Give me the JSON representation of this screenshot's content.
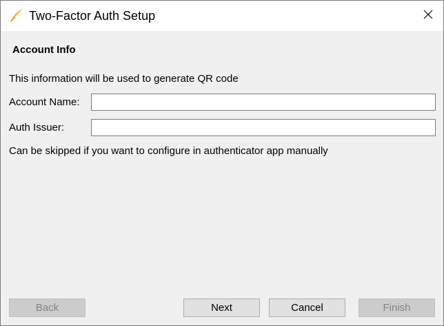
{
  "window": {
    "title": "Two-Factor Auth Setup",
    "icon": "feather-logo-icon",
    "close_icon": "close-icon"
  },
  "section": {
    "title": "Account Info"
  },
  "form": {
    "info_text": "This information will be used to generate QR code",
    "account_name_label": "Account Name:",
    "account_name_value": "",
    "auth_issuer_label": "Auth Issuer:",
    "auth_issuer_value": "",
    "hint_text": "Can be skipped if you want to configure in authenticator app manually"
  },
  "buttons": {
    "back": {
      "label": "Back",
      "enabled": false
    },
    "next": {
      "label": "Next",
      "enabled": true
    },
    "cancel": {
      "label": "Cancel",
      "enabled": true
    },
    "finish": {
      "label": "Finish",
      "enabled": false
    }
  },
  "colors": {
    "background": "#f0f0f0",
    "titlebar": "#ffffff",
    "feather_primary": "#f5a623",
    "feather_secondary": "#ffd27a",
    "disabled_text": "#838383"
  }
}
